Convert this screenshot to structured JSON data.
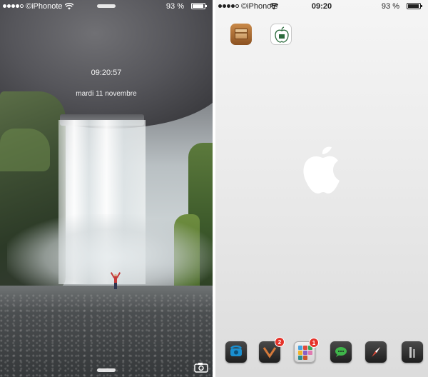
{
  "lock_screen": {
    "carrier": "©iPhonote",
    "battery": "93 %",
    "time": "09:20:57",
    "date": "mardi 11 novembre"
  },
  "home_screen": {
    "carrier": "©iPhonote",
    "time": "09:20",
    "battery": "93 %",
    "apps": [
      {
        "name": "cydia-icon"
      },
      {
        "name": "ifile-icon"
      }
    ],
    "dock": [
      {
        "name": "phone-icon",
        "badge": ""
      },
      {
        "name": "mail-icon",
        "badge": "2"
      },
      {
        "name": "folder-icon",
        "badge": "1"
      },
      {
        "name": "messages-icon",
        "badge": ""
      },
      {
        "name": "safari-icon",
        "badge": ""
      },
      {
        "name": "music-icon",
        "badge": ""
      }
    ]
  },
  "colors": {
    "badge": "#e5342b",
    "accent_orange": "#d4793a"
  }
}
